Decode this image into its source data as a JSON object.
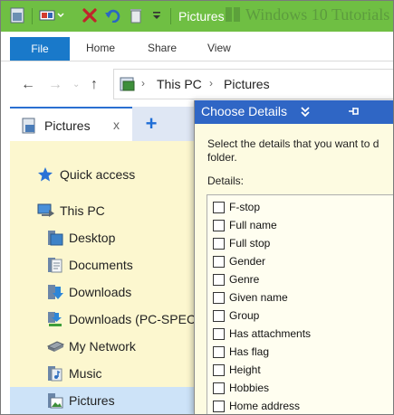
{
  "window": {
    "title": "Pictures",
    "background_title": "Windows 10 Tutorials"
  },
  "ribbon": {
    "tabs": [
      "File",
      "Home",
      "Share",
      "View"
    ]
  },
  "address": {
    "crumbs": [
      "This PC",
      "Pictures"
    ]
  },
  "panel_tab": {
    "label": "Pictures",
    "close": "x",
    "add": "+"
  },
  "nav_items": [
    {
      "label": "Quick access",
      "icon": "star-icon"
    },
    {
      "label": "This PC",
      "icon": "computer-icon"
    },
    {
      "label": "Desktop",
      "icon": "desktop-folder-icon"
    },
    {
      "label": "Documents",
      "icon": "documents-folder-icon"
    },
    {
      "label": "Downloads",
      "icon": "downloads-folder-icon"
    },
    {
      "label": "Downloads (PC-SPEC",
      "icon": "network-downloads-icon"
    },
    {
      "label": "My Network",
      "icon": "network-drive-icon"
    },
    {
      "label": "Music",
      "icon": "music-folder-icon"
    },
    {
      "label": "Pictures",
      "icon": "pictures-folder-icon",
      "selected": true
    }
  ],
  "dialog": {
    "title": "Choose Details",
    "description": "Select the details that you want to d\nfolder.",
    "details_label": "Details:",
    "items": [
      "F-stop",
      "Full name",
      "Full stop",
      "Gender",
      "Genre",
      "Given name",
      "Group",
      "Has attachments",
      "Has flag",
      "Height",
      "Hobbies",
      "Home address"
    ]
  },
  "colors": {
    "title_bar": "#6fbf43",
    "file_tab": "#1979ca",
    "dialog_title": "#2f66c5",
    "nav_pane": "#fcf7cf",
    "selection": "#cde3f8"
  }
}
